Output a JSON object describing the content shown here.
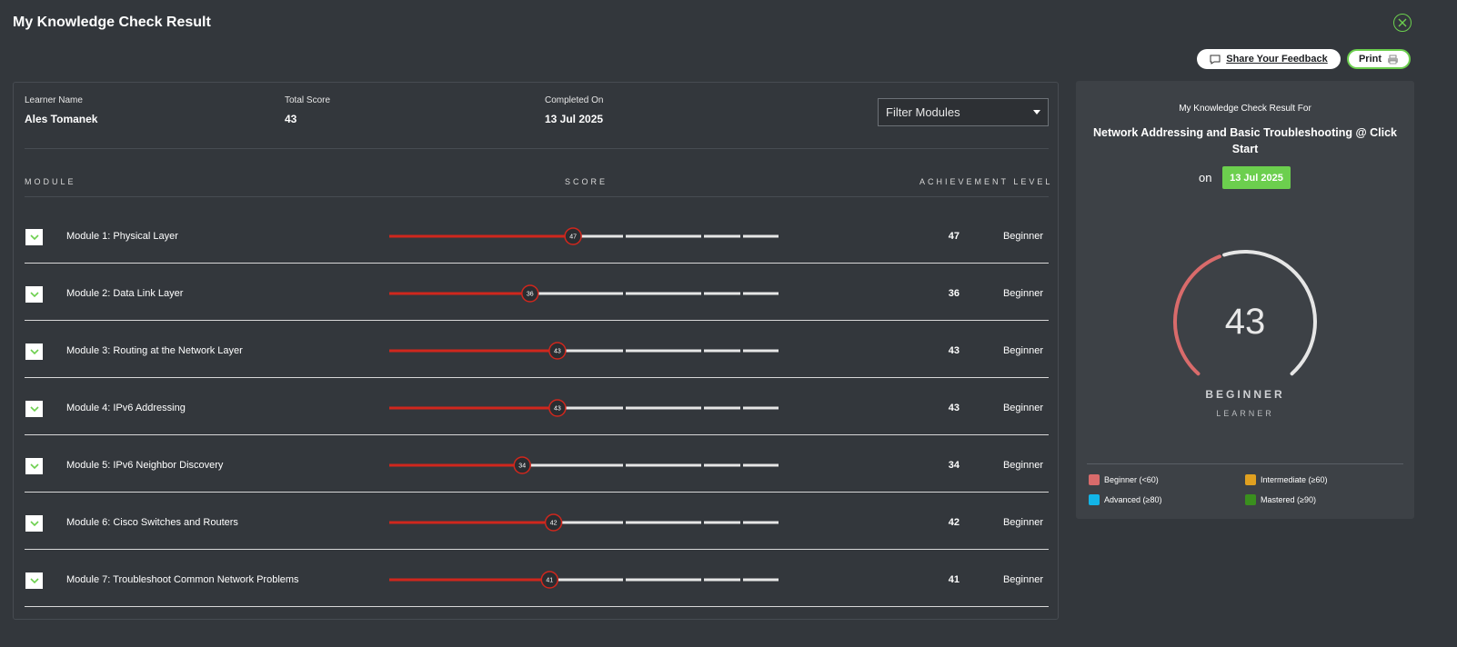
{
  "page_title": "My Knowledge Check Result",
  "header": {
    "feedback_label": "Share Your Feedback",
    "print_label": "Print"
  },
  "info": {
    "learner_label": "Learner Name",
    "learner_value": "Ales Tomanek",
    "score_label": "Total Score",
    "score_value": "43",
    "completed_label": "Completed On",
    "completed_value": "13 Jul 2025"
  },
  "filter": {
    "label": "Filter Modules"
  },
  "columns": {
    "module": "MODULE",
    "score": "SCORE",
    "achievement": "ACHIEVEMENT LEVEL"
  },
  "modules": [
    {
      "name": "Module 1: Physical Layer",
      "score": 47,
      "score_text": "47",
      "level": "Beginner"
    },
    {
      "name": "Module 2: Data Link Layer",
      "score": 36,
      "score_text": "36",
      "level": "Beginner"
    },
    {
      "name": "Module 3: Routing at the Network Layer",
      "score": 43,
      "score_text": "43",
      "level": "Beginner"
    },
    {
      "name": "Module 4: IPv6 Addressing",
      "score": 43,
      "score_text": "43",
      "level": "Beginner"
    },
    {
      "name": "Module 5: IPv6 Neighbor Discovery",
      "score": 34,
      "score_text": "34",
      "level": "Beginner"
    },
    {
      "name": "Module 6: Cisco Switches and Routers",
      "score": 42,
      "score_text": "42",
      "level": "Beginner"
    },
    {
      "name": "Module 7: Troubleshoot Common Network Problems",
      "score": 41,
      "score_text": "41",
      "level": "Beginner"
    }
  ],
  "summary": {
    "heading": "My Knowledge Check Result For",
    "course": "Network Addressing and Basic Troubleshooting @ Click Start",
    "on_label": "on",
    "date": "13 Jul 2025",
    "score": 43,
    "score_text": "43",
    "level": "BEGINNER",
    "sublevel": "LEARNER"
  },
  "legend": [
    {
      "label": "Beginner (<60)",
      "color": "#d96b6b"
    },
    {
      "label": "Intermediate (≥60)",
      "color": "#e0a020"
    },
    {
      "label": "Advanced (≥80)",
      "color": "#12b5e8"
    },
    {
      "label": "Mastered (≥90)",
      "color": "#3a8f1e"
    }
  ],
  "colors": {
    "accent": "#6ccf4e",
    "bar_fill": "#d0271d",
    "bar_track": "#e6e6e6"
  }
}
